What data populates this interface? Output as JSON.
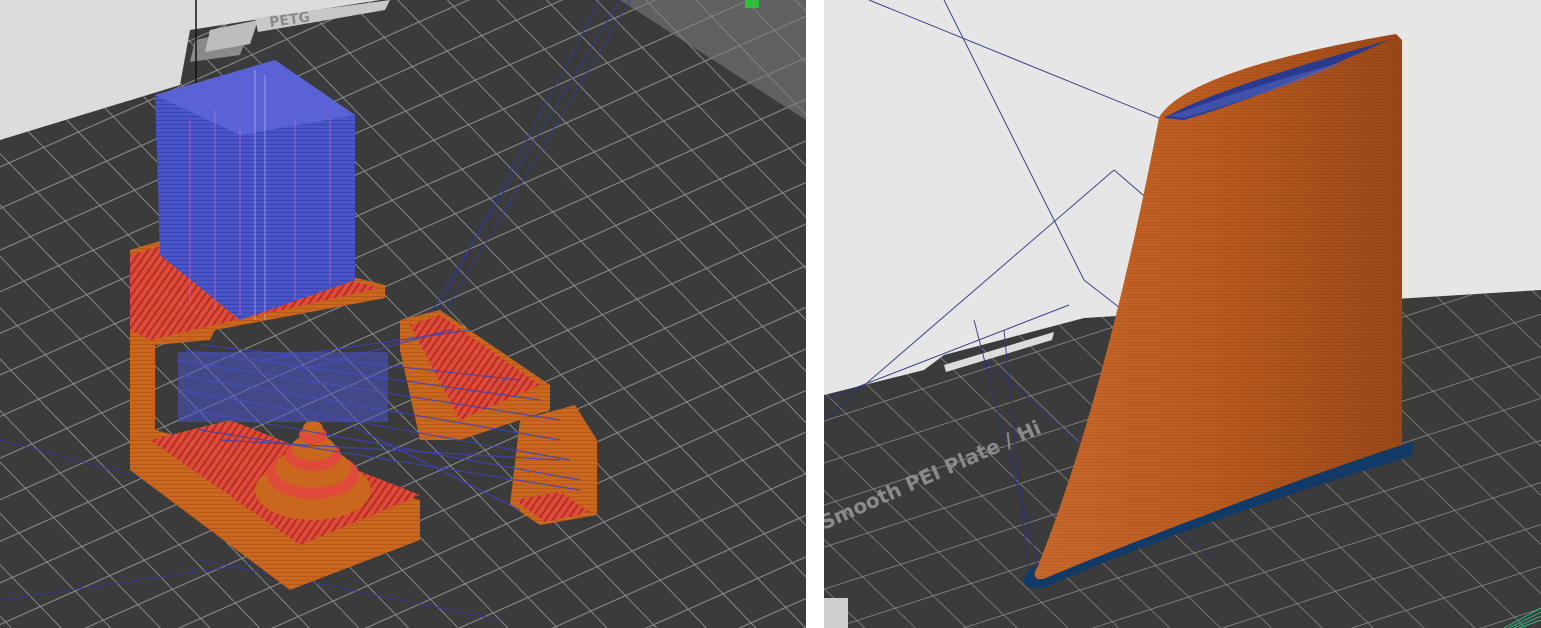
{
  "left_viewport": {
    "plate_label": "PETG",
    "filament_colors": {
      "wall": "#c9671f",
      "wall_dark": "#a6521a",
      "top_surface": "#e04a3a",
      "support": "#4a55c8",
      "travel": "#2d3aa0",
      "bed": "#3b3b3b",
      "grid": "#8c8c8c"
    }
  },
  "right_viewport": {
    "plate_label": "Smooth PEI Plate / Hi",
    "filament_colors": {
      "wall": "#c0611f",
      "brim": "#123a66",
      "travel": "#2a3580",
      "bed": "#3b3b3b",
      "grid": "#8c8c8c"
    }
  },
  "icons": {
    "axis": "axis-indicator-icon"
  }
}
